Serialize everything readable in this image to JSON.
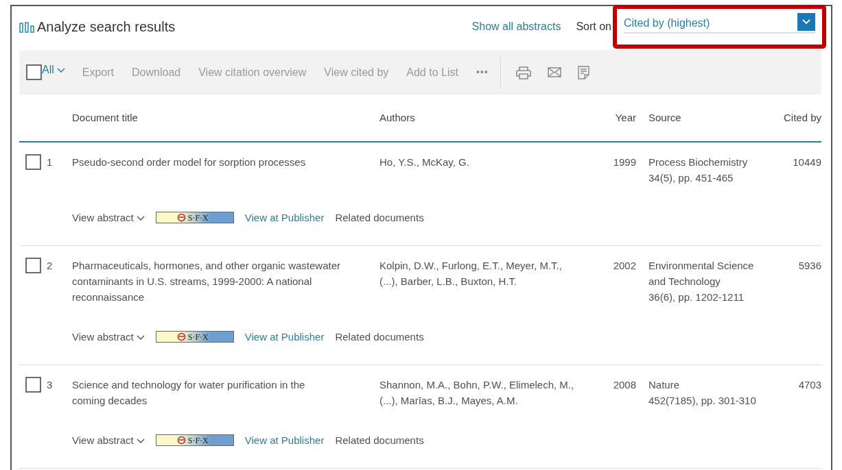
{
  "header": {
    "title": "Analyze search results",
    "show_abstracts": "Show all abstracts",
    "sort_label": "Sort on",
    "sort_value": "Cited by (highest)",
    "highlighted": true
  },
  "toolbar": {
    "select_all": {
      "label": "All",
      "checked": false
    },
    "actions": [
      {
        "label": "Export",
        "disabled": true
      },
      {
        "label": "Download",
        "disabled": true
      },
      {
        "label": "View citation overview",
        "disabled": true
      },
      {
        "label": "View cited by",
        "disabled": true
      },
      {
        "label": "Add to List",
        "disabled": true
      }
    ],
    "more": "•••",
    "icons": [
      {
        "kind": "print"
      },
      {
        "kind": "email"
      },
      {
        "kind": "pdf"
      }
    ]
  },
  "table": {
    "columns": [
      "Document title",
      "Authors",
      "Year",
      "Source",
      "Cited by"
    ],
    "rows": [
      {
        "number": "1",
        "checked": false,
        "title": [
          "Pseudo-second order model for sorption processes"
        ],
        "authors": [
          "Ho, Y.S., McKay, G."
        ],
        "year": "1999",
        "source": [
          "Process Biochemistry",
          "34(5), pp. 451-465"
        ],
        "cited_by": "10449",
        "view_abstract": "View abstract",
        "sfx": "S·F·X",
        "publisher": "View at Publisher",
        "related": "Related documents"
      },
      {
        "number": "2",
        "checked": false,
        "title": [
          "Pharmaceuticals, hormones, and other organic wastewater",
          "contaminants in U.S. streams, 1999-2000: A national",
          "reconnaissance"
        ],
        "authors": [
          "Kolpin, D.W., Furlong, E.T., Meyer, M.T.,",
          "(...), Barber, L.B., Buxton, H.T."
        ],
        "year": "2002",
        "source": [
          "Environmental Science",
          "and Technology",
          "36(6), pp. 1202-1211"
        ],
        "cited_by": "5936",
        "view_abstract": "View abstract",
        "sfx": "S·F·X",
        "publisher": "View at Publisher",
        "related": "Related documents"
      },
      {
        "number": "3",
        "checked": false,
        "title": [
          "Science and technology for water purification in the",
          "coming decades"
        ],
        "authors": [
          "Shannon, M.A., Bohn, P.W., Elimelech, M.,",
          "(...), Marīas, B.J., Mayes, A.M."
        ],
        "year": "2008",
        "source": [
          "Nature",
          "452(7185), pp. 301-310"
        ],
        "cited_by": "4703",
        "view_abstract": "View abstract",
        "sfx": "S·F·X",
        "publisher": "View at Publisher",
        "related": "Related documents"
      }
    ]
  }
}
